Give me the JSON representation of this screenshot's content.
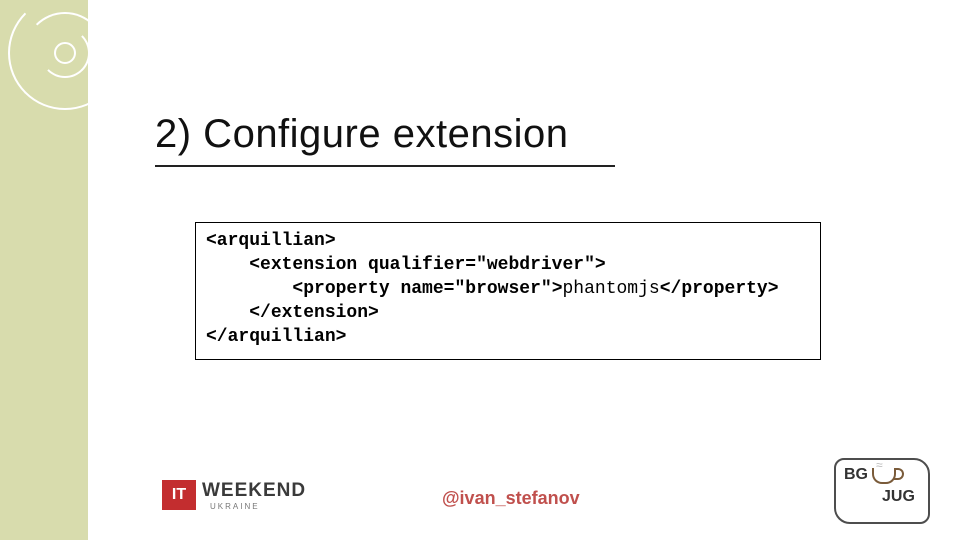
{
  "heading": "2) Configure extension",
  "code": {
    "arquillian_open": "<arquillian>",
    "extension_open_left": "<extension ",
    "extension_attr": "qualifier=\"webdriver\"",
    "extension_open_right": ">",
    "property_open_left": "<property ",
    "property_attr": "name=\"browser\"",
    "property_open_right": ">",
    "property_value": "phantomjs",
    "property_close": "</property>",
    "extension_close": "</extension>",
    "arquillian_close": "</arquillian>"
  },
  "footer": {
    "handle": "@ivan_stefanov",
    "it_logo_box": "IT",
    "it_logo_text": "WEEKEND",
    "it_logo_sub": "UKRAINE",
    "jug_bg": "BG",
    "jug_jug": "JUG",
    "jug_steam": "≈"
  }
}
